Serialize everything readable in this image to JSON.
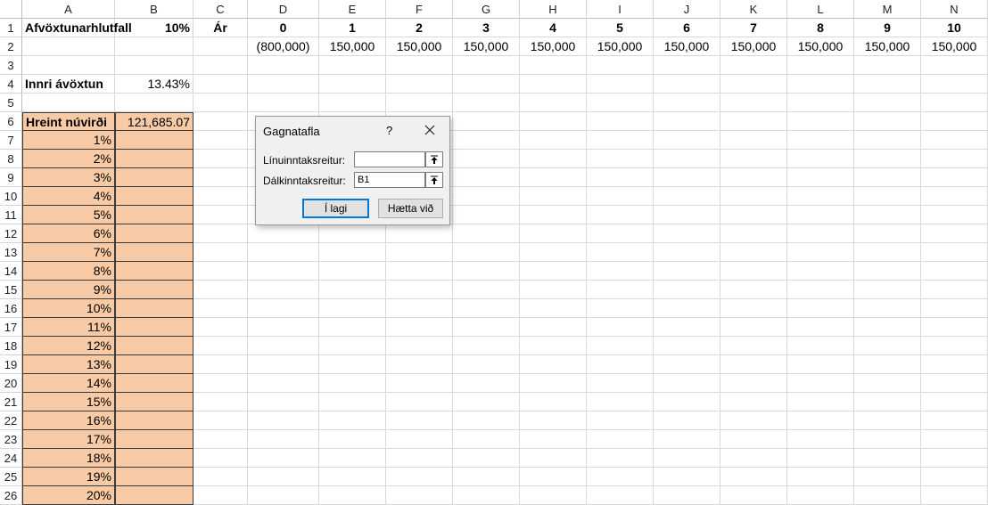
{
  "columns": [
    "A",
    "B",
    "C",
    "D",
    "E",
    "F",
    "G",
    "H",
    "I",
    "J",
    "K",
    "L",
    "M",
    "N"
  ],
  "rows": [
    "1",
    "2",
    "3",
    "4",
    "5",
    "6",
    "7",
    "8",
    "9",
    "10",
    "11",
    "12",
    "13",
    "14",
    "15",
    "16",
    "17",
    "18",
    "19",
    "20",
    "21",
    "22",
    "23",
    "24",
    "25",
    "26"
  ],
  "sheet": {
    "A1": "Afvöxtunarhlutfall",
    "B1": "10%",
    "C1": "Ár",
    "years": [
      "0",
      "1",
      "2",
      "3",
      "4",
      "5",
      "6",
      "7",
      "8",
      "9",
      "10"
    ],
    "cashflows": [
      "(800,000)",
      "150,000",
      "150,000",
      "150,000",
      "150,000",
      "150,000",
      "150,000",
      "150,000",
      "150,000",
      "150,000",
      "150,000"
    ],
    "A4": "Innri ávöxtun",
    "B4": "13.43%",
    "A6": "Hreint núvirði",
    "B6": "121,685.07",
    "rates": [
      "1%",
      "2%",
      "3%",
      "4%",
      "5%",
      "6%",
      "7%",
      "8%",
      "9%",
      "10%",
      "11%",
      "12%",
      "13%",
      "14%",
      "15%",
      "16%",
      "17%",
      "18%",
      "19%",
      "20%"
    ]
  },
  "dialog": {
    "title": "Gagnatafla",
    "help": "?",
    "row_input_label": "Línuinntaksreitur:",
    "row_input_value": "",
    "col_input_label": "Dálkinntaksreitur:",
    "col_input_value": "B1",
    "ok_label": "Í lagi",
    "cancel_label": "Hætta við"
  }
}
